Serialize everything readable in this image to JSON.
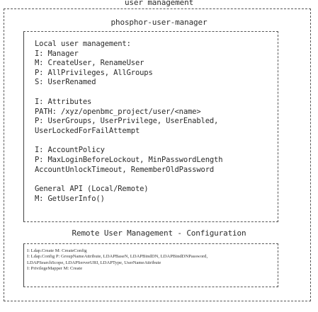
{
  "title": "user management",
  "manager": {
    "title": "phosphor-user-manager",
    "sections": [
      [
        "Local user management:",
        "I: Manager",
        "M: CreateUser, RenameUser",
        "P: AllPrivileges, AllGroups",
        "S: UserRenamed"
      ],
      [
        "I: Attributes",
        "PATH: /xyz/openbmc_project/user/<name>",
        "P: UserGroups, UserPrivilege, UserEnabled,",
        "UserLockedForFailAttempt"
      ],
      [
        "I: AccountPolicy",
        "P: MaxLoginBeforeLockout, MinPasswordLength",
        "AccountUnlockTimeout, RememberOldPassword"
      ],
      [
        "General API (Local/Remote)",
        "M: GetUserInfo()"
      ]
    ]
  },
  "remote": {
    "title": "Remote User Management - Configuration",
    "lines": [
      "I: Ldap.Create M: CreateConfig",
      "I: Ldap.Config P: GroupNameAttribute, LDAPBaseN, LDAPBindDN, LDAPBindDNPassword,",
      "LDAPSearchScope, LDAPServerURI, LDAPType, UserNameAttribute",
      "I: PrivilegeMapper M: Create"
    ]
  }
}
